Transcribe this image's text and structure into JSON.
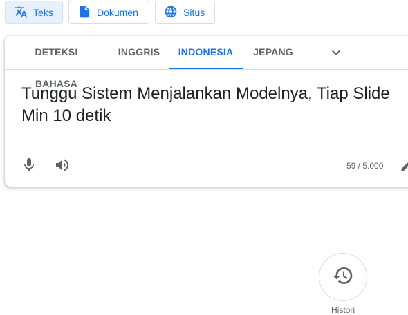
{
  "mode_tabs": [
    {
      "label": "Teks",
      "icon": "translate-icon",
      "active": true
    },
    {
      "label": "Dokumen",
      "icon": "document-icon",
      "active": false
    },
    {
      "label": "Situs",
      "icon": "globe-icon",
      "active": false
    }
  ],
  "language_tabs": [
    {
      "label": "DETEKSI BAHASA",
      "active": false
    },
    {
      "label": "INGGRIS",
      "active": false
    },
    {
      "label": "INDONESIA",
      "active": true
    },
    {
      "label": "JEPANG",
      "active": false
    }
  ],
  "source": {
    "text": "Tunggu Sistem Menjalankan Modelnya, Tiap Slide Min 10 detik",
    "char_count": "59 / 5.000"
  },
  "history": {
    "label": "Histori"
  },
  "colors": {
    "accent": "#1a73e8",
    "active_bg": "#e8f0fe",
    "icon_gray": "#5f6368"
  }
}
